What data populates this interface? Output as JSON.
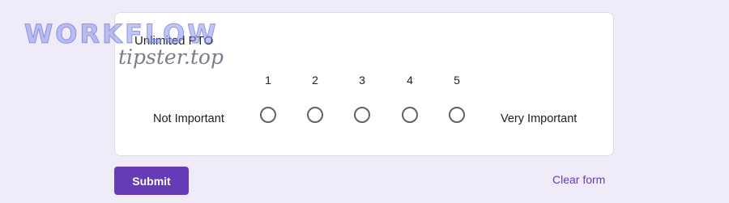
{
  "question": {
    "title": "Unlimited PTO",
    "low_label": "Not Important",
    "high_label": "Very Important",
    "options": [
      "1",
      "2",
      "3",
      "4",
      "5"
    ]
  },
  "actions": {
    "submit_label": "Submit",
    "clear_label": "Clear form"
  },
  "watermark": {
    "main": "WORKFLOW",
    "sub": "tipster.top"
  },
  "colors": {
    "background": "#f0ebf8",
    "accent": "#673ab7",
    "radio_border": "#5f6368"
  }
}
